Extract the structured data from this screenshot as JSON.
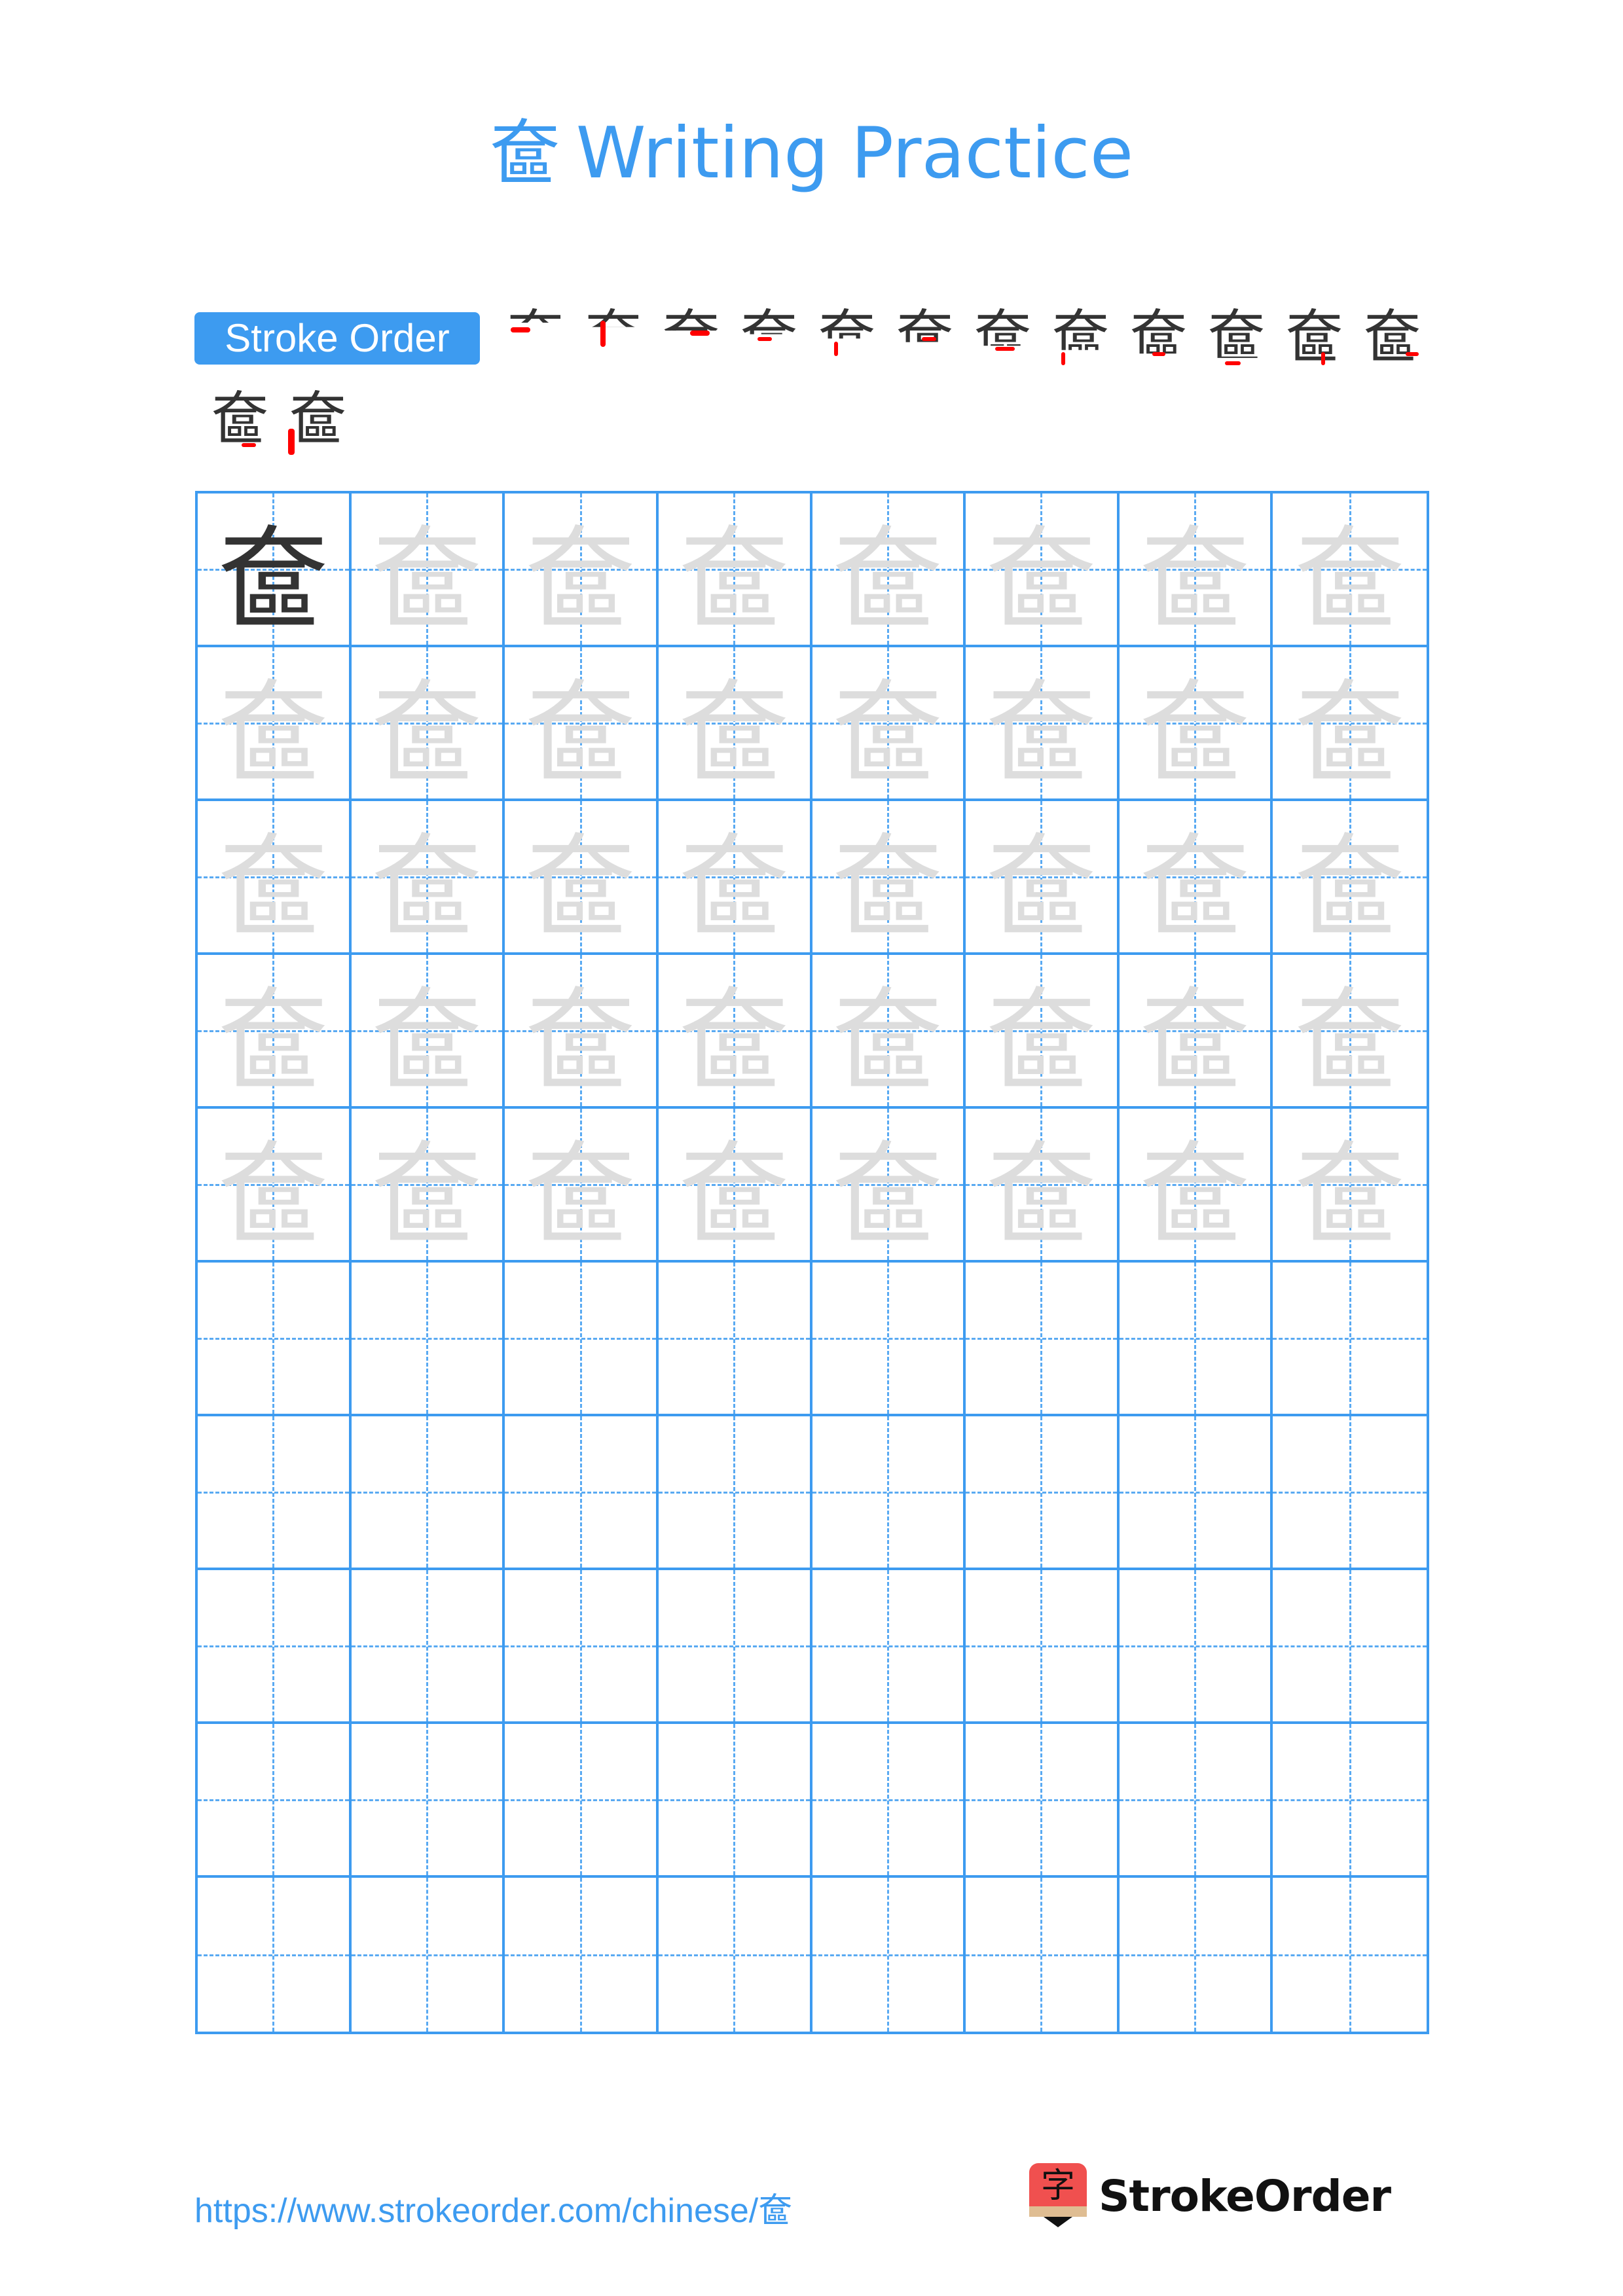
{
  "page": {
    "character": "奩",
    "title_suffix": "Writing Practice"
  },
  "stroke_order": {
    "label": "Stroke Order",
    "total_strokes": 14,
    "row1_steps": [
      1,
      2,
      3,
      4,
      5,
      6,
      7,
      8,
      9,
      10,
      11,
      12
    ],
    "row2_steps": [
      13,
      14
    ],
    "highlight_color": "#ff0000",
    "glyph_color": "#333333"
  },
  "grid": {
    "columns": 8,
    "rows": 10,
    "model_cells": 1,
    "trace_rows": 5,
    "empty_rows": 5,
    "line_color": "#3d9bf0",
    "model_color": "#333333",
    "trace_color": "#dddddd"
  },
  "footer": {
    "url": "https://www.strokeorder.com/chinese/奩",
    "logo_glyph": "字",
    "logo_text": "StrokeOrder"
  }
}
